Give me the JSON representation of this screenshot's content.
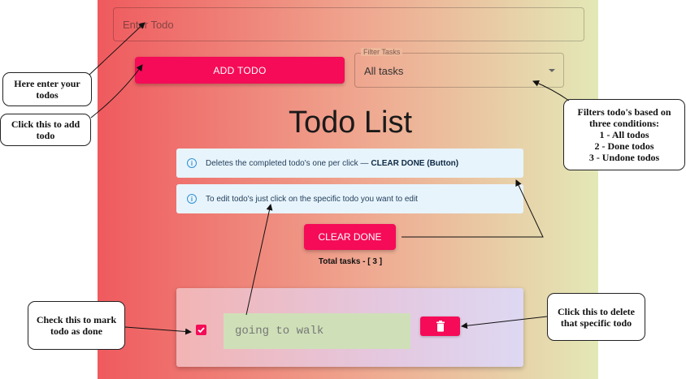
{
  "todo_input": {
    "placeholder": "Enter Todo",
    "value": ""
  },
  "add_button": {
    "label": "ADD TODO"
  },
  "filter": {
    "label": "Filter Tasks",
    "selected": "All tasks"
  },
  "page_title": "Todo List",
  "alerts": [
    {
      "text": "Deletes the completed todo's one per click — ",
      "bold": "CLEAR DONE (Button)"
    },
    {
      "text": "To edit todo's just click on the specific todo you want to edit"
    }
  ],
  "clear_button": {
    "label": "CLEAR DONE"
  },
  "total_tasks": "Total tasks - [ 3 ]",
  "todos": [
    {
      "text": "going to walk",
      "done": true
    }
  ],
  "callouts": {
    "enter": [
      "Here enter your",
      "todos"
    ],
    "add": [
      "Click this to add",
      "todo"
    ],
    "filter": [
      "Filters todo's based on",
      "three conditions:",
      "1 - All todos",
      "2 - Done todos",
      "3 - Undone todos"
    ],
    "check": [
      "Check this to mark",
      "todo as done"
    ],
    "delete": [
      "Click this to delete",
      "that specific todo"
    ]
  },
  "colors": {
    "accent": "#f50b57",
    "info": "#2f90d6"
  }
}
